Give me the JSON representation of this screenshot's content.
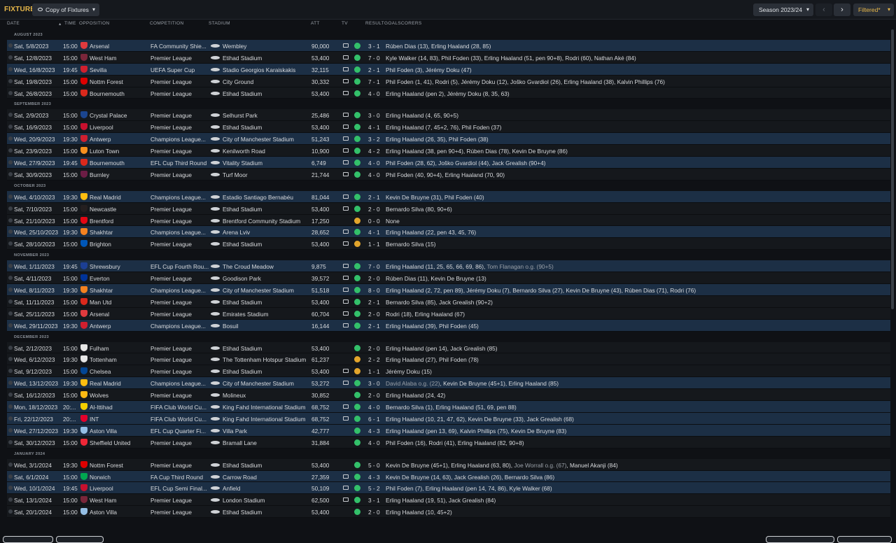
{
  "header": {
    "title": "FIXTURES",
    "view": "Copy of Fixtures",
    "season": "Season 2023/24",
    "filter": "Filtered*"
  },
  "columns": {
    "date": "DATE",
    "time": "TIME",
    "opposition": "OPPOSITION",
    "competition": "COMPETITION",
    "stadium": "STADIUM",
    "att": "ATT",
    "tv": "TV",
    "result": "RESULT",
    "goalscorers": "GOALSCORERS"
  },
  "colors": {
    "accent": "#e8b84a",
    "win": "#33c06a",
    "draw": "#e2a52c",
    "row_highlight": "#1c2f45"
  },
  "months": [
    {
      "label": "AUGUST 2023",
      "fixtures": [
        {
          "date": "Sat, 5/8/2023",
          "time": "15:00",
          "opp": "Arsenal",
          "badge": "#e03a3e",
          "comp": "FA Community Shie...",
          "stadium": "Wembley",
          "att": "90,000",
          "tv": true,
          "res": "w",
          "score": "3 - 1",
          "goals": [
            {
              "t": "Rúben Dias (13), Erling Haaland (28, 85)"
            }
          ],
          "alt": true
        },
        {
          "date": "Sat, 12/8/2023",
          "time": "15:00",
          "opp": "West Ham",
          "badge": "#7a263a",
          "comp": "Premier League",
          "stadium": "Etihad Stadium",
          "att": "53,400",
          "tv": true,
          "res": "w",
          "score": "7 - 0",
          "goals": [
            {
              "t": "Kyle Walker (14, 83), Phil Foden (33), Erling Haaland (51, pen 90+8), Rodri (60), Nathan Aké (84)"
            }
          ],
          "alt": false
        },
        {
          "date": "Wed, 16/8/2023",
          "time": "19:45",
          "opp": "Sevilla",
          "badge": "#d0202e",
          "comp": "UEFA Super Cup",
          "stadium": "Stadio Georgios Karaiskakis",
          "att": "32,115",
          "tv": true,
          "res": "w",
          "score": "2 - 1",
          "goals": [
            {
              "t": "Phil Foden (3), Jérémy Doku (47)"
            }
          ],
          "alt": true
        },
        {
          "date": "Sat, 19/8/2023",
          "time": "15:00",
          "opp": "Nottm Forest",
          "badge": "#dd0000",
          "comp": "Premier League",
          "stadium": "City Ground",
          "att": "30,332",
          "tv": true,
          "res": "w",
          "score": "7 - 1",
          "goals": [
            {
              "t": "Phil Foden (1, 41), Rodri (5), Jérémy Doku (12), Joško Gvardiol (26), Erling Haaland (38), Kalvin Phillips (76)"
            }
          ],
          "alt": false
        },
        {
          "date": "Sat, 26/8/2023",
          "time": "15:00",
          "opp": "Bournemouth",
          "badge": "#da291c",
          "comp": "Premier League",
          "stadium": "Etihad Stadium",
          "att": "53,400",
          "tv": true,
          "res": "w",
          "score": "4 - 0",
          "goals": [
            {
              "t": "Erling Haaland (pen 2), Jérémy Doku (8, 35, 63)"
            }
          ],
          "alt": false
        }
      ]
    },
    {
      "label": "SEPTEMBER 2023",
      "fixtures": [
        {
          "date": "Sat, 2/9/2023",
          "time": "15:00",
          "opp": "Crystal Palace",
          "badge": "#1b458f",
          "comp": "Premier League",
          "stadium": "Selhurst Park",
          "att": "25,486",
          "tv": true,
          "res": "w",
          "score": "3 - 0",
          "goals": [
            {
              "t": "Erling Haaland (4, 65, 90+5)"
            }
          ],
          "alt": false
        },
        {
          "date": "Sat, 16/9/2023",
          "time": "15:00",
          "opp": "Liverpool",
          "badge": "#c8102e",
          "comp": "Premier League",
          "stadium": "Etihad Stadium",
          "att": "53,400",
          "tv": true,
          "res": "w",
          "score": "4 - 1",
          "goals": [
            {
              "t": "Erling Haaland (7, 45+2, 76), Phil Foden (37)"
            }
          ],
          "alt": false
        },
        {
          "date": "Wed, 20/9/2023",
          "time": "19:30",
          "opp": "Antwerp",
          "badge": "#d01f2f",
          "comp": "Champions League...",
          "stadium": "City of Manchester Stadium",
          "att": "51,243",
          "tv": true,
          "res": "w",
          "score": "3 - 2",
          "goals": [
            {
              "t": "Erling Haaland (26, 35), Phil Foden (38)"
            }
          ],
          "alt": true
        },
        {
          "date": "Sat, 23/9/2023",
          "time": "15:00",
          "opp": "Luton Town",
          "badge": "#f78f1e",
          "comp": "Premier League",
          "stadium": "Kenilworth Road",
          "att": "10,900",
          "tv": true,
          "res": "w",
          "score": "4 - 2",
          "goals": [
            {
              "t": "Erling Haaland (38, pen 90+4), Rúben Dias (78), Kevin De Bruyne (86)"
            }
          ],
          "alt": false
        },
        {
          "date": "Wed, 27/9/2023",
          "time": "19:45",
          "opp": "Bournemouth",
          "badge": "#da291c",
          "comp": "EFL Cup Third Round",
          "stadium": "Vitality Stadium",
          "att": "6,749",
          "tv": true,
          "res": "w",
          "score": "4 - 0",
          "goals": [
            {
              "t": "Phil Foden (28, 62), Joško Gvardiol (44), Jack Grealish (90+4)"
            }
          ],
          "alt": true
        },
        {
          "date": "Sat, 30/9/2023",
          "time": "15:00",
          "opp": "Burnley",
          "badge": "#6c1d45",
          "comp": "Premier League",
          "stadium": "Turf Moor",
          "att": "21,744",
          "tv": true,
          "res": "w",
          "score": "4 - 0",
          "goals": [
            {
              "t": "Phil Foden (40, 90+4), Erling Haaland (70, 90)"
            }
          ],
          "alt": false
        }
      ]
    },
    {
      "label": "OCTOBER 2023",
      "fixtures": [
        {
          "date": "Wed, 4/10/2023",
          "time": "19:30",
          "opp": "Real Madrid",
          "badge": "#febe10",
          "comp": "Champions League...",
          "stadium": "Estadio Santiago Bernabéu",
          "att": "81,044",
          "tv": true,
          "res": "w",
          "score": "2 - 1",
          "goals": [
            {
              "t": "Kevin De Bruyne (31), Phil Foden (40)"
            }
          ],
          "alt": true
        },
        {
          "date": "Sat, 7/10/2023",
          "time": "15:00",
          "opp": "Newcastle",
          "badge": "#241f20",
          "comp": "Premier League",
          "stadium": "Etihad Stadium",
          "att": "53,400",
          "tv": true,
          "res": "w",
          "score": "2 - 0",
          "goals": [
            {
              "t": "Bernardo Silva (80, 90+6)"
            }
          ],
          "alt": false
        },
        {
          "date": "Sat, 21/10/2023",
          "time": "15:00",
          "opp": "Brentford",
          "badge": "#e30613",
          "comp": "Premier League",
          "stadium": "Brentford Community Stadium",
          "att": "17,250",
          "tv": false,
          "res": "d",
          "score": "0 - 0",
          "goals": [
            {
              "t": "None"
            }
          ],
          "alt": false
        },
        {
          "date": "Wed, 25/10/2023",
          "time": "19:30",
          "opp": "Shakhtar",
          "badge": "#f58220",
          "comp": "Champions League...",
          "stadium": "Arena Lviv",
          "att": "28,652",
          "tv": true,
          "res": "w",
          "score": "4 - 1",
          "goals": [
            {
              "t": "Erling Haaland (22, pen 43, 45, 76)"
            }
          ],
          "alt": true
        },
        {
          "date": "Sat, 28/10/2023",
          "time": "15:00",
          "opp": "Brighton",
          "badge": "#0057b8",
          "comp": "Premier League",
          "stadium": "Etihad Stadium",
          "att": "53,400",
          "tv": true,
          "res": "d",
          "score": "1 - 1",
          "goals": [
            {
              "t": "Bernardo Silva (15)"
            }
          ],
          "alt": false
        }
      ]
    },
    {
      "label": "NOVEMBER 2023",
      "fixtures": [
        {
          "date": "Wed, 1/11/2023",
          "time": "19:45",
          "opp": "Shrewsbury",
          "badge": "#1c3f94",
          "comp": "EFL Cup Fourth Rou...",
          "stadium": "The Croud Meadow",
          "att": "9,875",
          "tv": true,
          "res": "w",
          "score": "7 - 0",
          "goals": [
            {
              "t": "Erling Haaland (11, 25, 65, 66, 69, 86), "
            },
            {
              "t": "Tom Flanagan o.g. (90+5)",
              "og": true
            }
          ],
          "alt": true
        },
        {
          "date": "Sat, 4/11/2023",
          "time": "15:00",
          "opp": "Everton",
          "badge": "#003399",
          "comp": "Premier League",
          "stadium": "Goodison Park",
          "att": "39,572",
          "tv": true,
          "res": "w",
          "score": "2 - 0",
          "goals": [
            {
              "t": "Rúben Dias (11), Kevin De Bruyne (13)"
            }
          ],
          "alt": false
        },
        {
          "date": "Wed, 8/11/2023",
          "time": "19:30",
          "opp": "Shakhtar",
          "badge": "#f58220",
          "comp": "Champions League...",
          "stadium": "City of Manchester Stadium",
          "att": "51,518",
          "tv": true,
          "res": "w",
          "score": "8 - 0",
          "goals": [
            {
              "t": "Erling Haaland (2, 72, pen 89), Jérémy Doku (7), Bernardo Silva (27), Kevin De Bruyne (43), Rúben Dias (71), Rodri (76)"
            }
          ],
          "alt": true
        },
        {
          "date": "Sat, 11/11/2023",
          "time": "15:00",
          "opp": "Man Utd",
          "badge": "#da291c",
          "comp": "Premier League",
          "stadium": "Etihad Stadium",
          "att": "53,400",
          "tv": true,
          "res": "w",
          "score": "2 - 1",
          "goals": [
            {
              "t": "Bernardo Silva (85), Jack Grealish (90+2)"
            }
          ],
          "alt": false
        },
        {
          "date": "Sat, 25/11/2023",
          "time": "15:00",
          "opp": "Arsenal",
          "badge": "#e03a3e",
          "comp": "Premier League",
          "stadium": "Emirates Stadium",
          "att": "60,704",
          "tv": true,
          "res": "w",
          "score": "2 - 0",
          "goals": [
            {
              "t": "Rodri (18), Erling Haaland (67)"
            }
          ],
          "alt": false
        },
        {
          "date": "Wed, 29/11/2023",
          "time": "19:30",
          "opp": "Antwerp",
          "badge": "#d01f2f",
          "comp": "Champions League...",
          "stadium": "Bosuil",
          "att": "16,144",
          "tv": true,
          "res": "w",
          "score": "2 - 1",
          "goals": [
            {
              "t": "Erling Haaland (39), Phil Foden (45)"
            }
          ],
          "alt": true
        }
      ]
    },
    {
      "label": "DECEMBER 2023",
      "fixtures": [
        {
          "date": "Sat, 2/12/2023",
          "time": "15:00",
          "opp": "Fulham",
          "badge": "#e6e6e6",
          "comp": "Premier League",
          "stadium": "Etihad Stadium",
          "att": "53,400",
          "tv": false,
          "res": "w",
          "score": "2 - 0",
          "goals": [
            {
              "t": "Erling Haaland (pen 14), Jack Grealish (85)"
            }
          ],
          "alt": false
        },
        {
          "date": "Wed, 6/12/2023",
          "time": "19:30",
          "opp": "Tottenham",
          "badge": "#e6e6e6",
          "comp": "Premier League",
          "stadium": "The Tottenham Hotspur Stadium",
          "att": "61,237",
          "tv": false,
          "res": "d",
          "score": "2 - 2",
          "goals": [
            {
              "t": "Erling Haaland (27), Phil Foden (78)"
            }
          ],
          "alt": false
        },
        {
          "date": "Sat, 9/12/2023",
          "time": "15:00",
          "opp": "Chelsea",
          "badge": "#034694",
          "comp": "Premier League",
          "stadium": "Etihad Stadium",
          "att": "53,400",
          "tv": true,
          "res": "d",
          "score": "1 - 1",
          "goals": [
            {
              "t": "Jérémy Doku (15)"
            }
          ],
          "alt": false
        },
        {
          "date": "Wed, 13/12/2023",
          "time": "19:30",
          "opp": "Real Madrid",
          "badge": "#febe10",
          "comp": "Champions League...",
          "stadium": "City of Manchester Stadium",
          "att": "53,272",
          "tv": true,
          "res": "w",
          "score": "3 - 0",
          "goals": [
            {
              "t": "David Alaba o.g. (22)",
              "og": true
            },
            {
              "t": ", Kevin De Bruyne (45+1), Erling Haaland (85)"
            }
          ],
          "alt": true
        },
        {
          "date": "Sat, 16/12/2023",
          "time": "15:00",
          "opp": "Wolves",
          "badge": "#fdb913",
          "comp": "Premier League",
          "stadium": "Molineux",
          "att": "30,852",
          "tv": false,
          "res": "w",
          "score": "2 - 0",
          "goals": [
            {
              "t": "Erling Haaland (24, 42)"
            }
          ],
          "alt": false
        },
        {
          "date": "Mon, 18/12/2023",
          "time": "20:...",
          "opp": "Al-Ittihad",
          "badge": "#f5d000",
          "comp": "FIFA Club World Cu...",
          "stadium": "King Fahd International Stadium",
          "att": "68,752",
          "tv": true,
          "res": "w",
          "score": "4 - 0",
          "goals": [
            {
              "t": "Bernardo Silva (1), Erling Haaland (51, 69, pen 88)"
            }
          ],
          "alt": true
        },
        {
          "date": "Fri, 22/12/2023",
          "time": "20:...",
          "opp": "INT",
          "badge": "#e4002b",
          "comp": "FIFA Club World Cu...",
          "stadium": "King Fahd International Stadium",
          "att": "68,752",
          "tv": true,
          "res": "w",
          "score": "6 - 1",
          "goals": [
            {
              "t": "Erling Haaland (10, 21, 47, 62), Kevin De Bruyne (33), Jack Grealish (68)"
            }
          ],
          "alt": true
        },
        {
          "date": "Wed, 27/12/2023",
          "time": "19:30",
          "opp": "Aston Villa",
          "badge": "#95bfe5",
          "comp": "EFL Cup Quarter Fi...",
          "stadium": "Villa Park",
          "att": "42,777",
          "tv": false,
          "res": "w",
          "score": "4 - 3",
          "goals": [
            {
              "t": "Erling Haaland (pen 13, 69), Kalvin Phillips (75), Kevin De Bruyne (83)"
            }
          ],
          "alt": true
        },
        {
          "date": "Sat, 30/12/2023",
          "time": "15:00",
          "opp": "Sheffield United",
          "badge": "#ee2737",
          "comp": "Premier League",
          "stadium": "Bramall Lane",
          "att": "31,884",
          "tv": false,
          "res": "w",
          "score": "4 - 0",
          "goals": [
            {
              "t": "Phil Foden (16), Rodri (41), Erling Haaland (82, 90+8)"
            }
          ],
          "alt": false
        }
      ]
    },
    {
      "label": "JANUARY 2024",
      "fixtures": [
        {
          "date": "Wed, 3/1/2024",
          "time": "19:30",
          "opp": "Nottm Forest",
          "badge": "#dd0000",
          "comp": "Premier League",
          "stadium": "Etihad Stadium",
          "att": "53,400",
          "tv": false,
          "res": "w",
          "score": "5 - 0",
          "goals": [
            {
              "t": "Kevin De Bruyne (45+1), Erling Haaland (63, 80), "
            },
            {
              "t": "Joe Worrall o.g. (67)",
              "og": true
            },
            {
              "t": ", Manuel Akanji (84)"
            }
          ],
          "alt": false
        },
        {
          "date": "Sat, 6/1/2024",
          "time": "15:00",
          "opp": "Norwich",
          "badge": "#00a650",
          "comp": "FA Cup Third Round",
          "stadium": "Carrow Road",
          "att": "27,359",
          "tv": true,
          "res": "w",
          "score": "4 - 3",
          "goals": [
            {
              "t": "Kevin De Bruyne (14, 63), Jack Grealish (26), Bernardo Silva (86)"
            }
          ],
          "alt": true
        },
        {
          "date": "Wed, 10/1/2024",
          "time": "19:45",
          "opp": "Liverpool",
          "badge": "#c8102e",
          "comp": "EFL Cup Semi Final...",
          "stadium": "Anfield",
          "att": "50,109",
          "tv": true,
          "res": "w",
          "score": "5 - 2",
          "goals": [
            {
              "t": "Phil Foden (7), Erling Haaland (pen 14, 74, 86), Kyle Walker (68)"
            }
          ],
          "alt": true
        },
        {
          "date": "Sat, 13/1/2024",
          "time": "15:00",
          "opp": "West Ham",
          "badge": "#7a263a",
          "comp": "Premier League",
          "stadium": "London Stadium",
          "att": "62,500",
          "tv": true,
          "res": "w",
          "score": "3 - 1",
          "goals": [
            {
              "t": "Erling Haaland (19, 51), Jack Grealish (84)"
            }
          ],
          "alt": false
        },
        {
          "date": "Sat, 20/1/2024",
          "time": "15:00",
          "opp": "Aston Villa",
          "badge": "#95bfe5",
          "comp": "Premier League",
          "stadium": "Etihad Stadium",
          "att": "53,400",
          "tv": false,
          "res": "w",
          "score": "2 - 0",
          "goals": [
            {
              "t": "Erling Haaland (10, 45+2)"
            }
          ],
          "alt": false
        }
      ]
    }
  ]
}
